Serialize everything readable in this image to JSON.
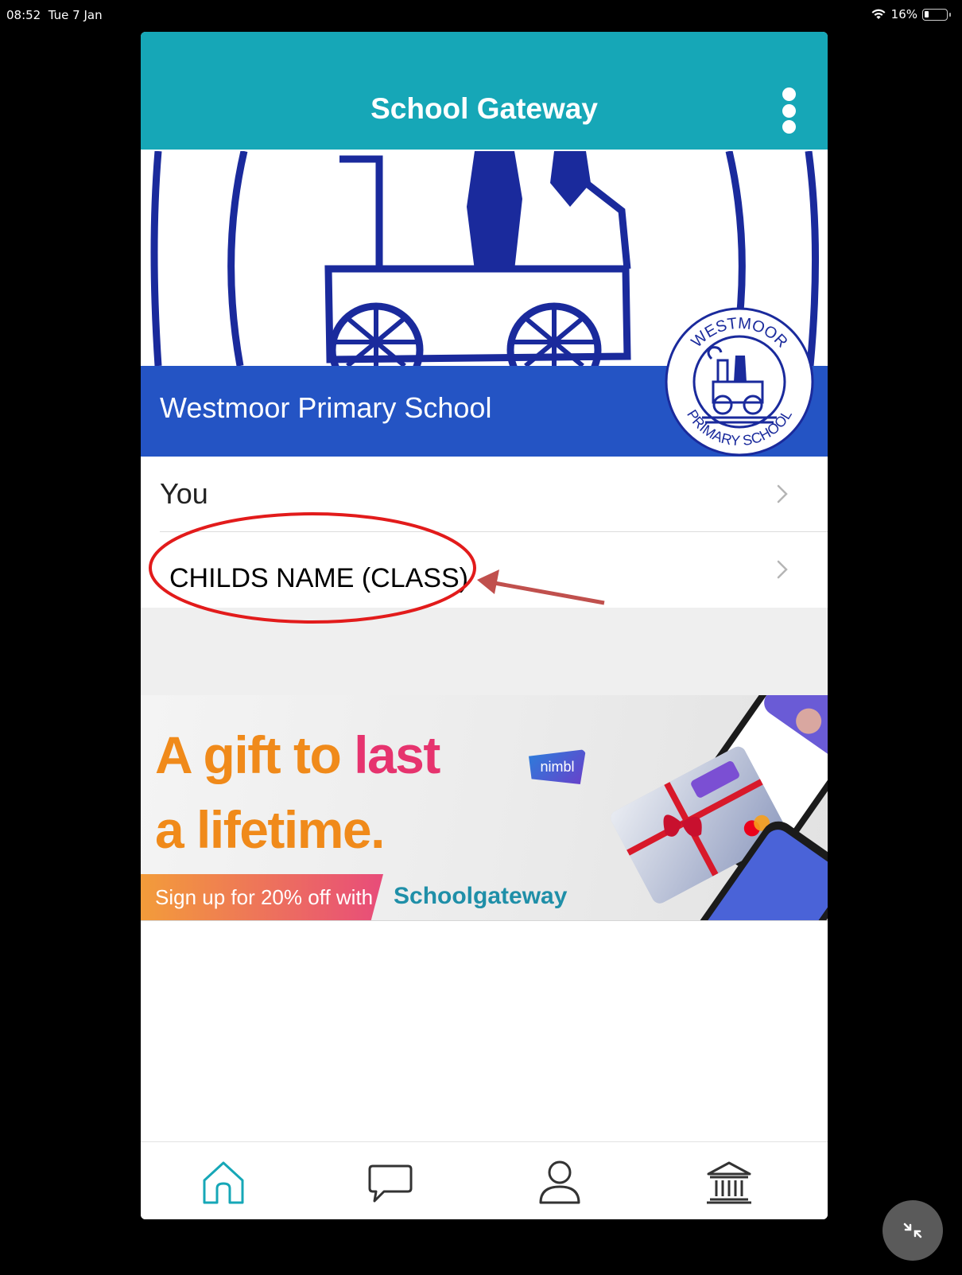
{
  "status_bar": {
    "time": "08:52",
    "date": "Tue 7 Jan",
    "battery": "16%"
  },
  "app": {
    "title": "School Gateway",
    "school": {
      "name": "Westmoor Primary School",
      "crest_top": "WESTMOOR",
      "crest_bottom": "PRIMARY SCHOOL"
    },
    "list": [
      {
        "label": "You"
      },
      {
        "label": "CHILDS NAME (CLASS)"
      }
    ],
    "ad": {
      "headline_line1_orange": "A gift to ",
      "headline_line1_pink": "last",
      "headline_line2": "a lifetime.",
      "signup": "Sign up for 20% off with",
      "brand": "Schoolgateway",
      "badge": "nimbl"
    },
    "tabs": [
      {
        "icon": "home-icon",
        "active": true
      },
      {
        "icon": "message-icon",
        "active": false
      },
      {
        "icon": "profile-icon",
        "active": false
      },
      {
        "icon": "bank-icon",
        "active": false
      }
    ]
  },
  "colors": {
    "header": "#16a7b7",
    "school_band": "#2454c4",
    "active_tab": "#16a7b7",
    "annotation_circle": "#e21b1b",
    "annotation_arrow": "#c0504d"
  }
}
